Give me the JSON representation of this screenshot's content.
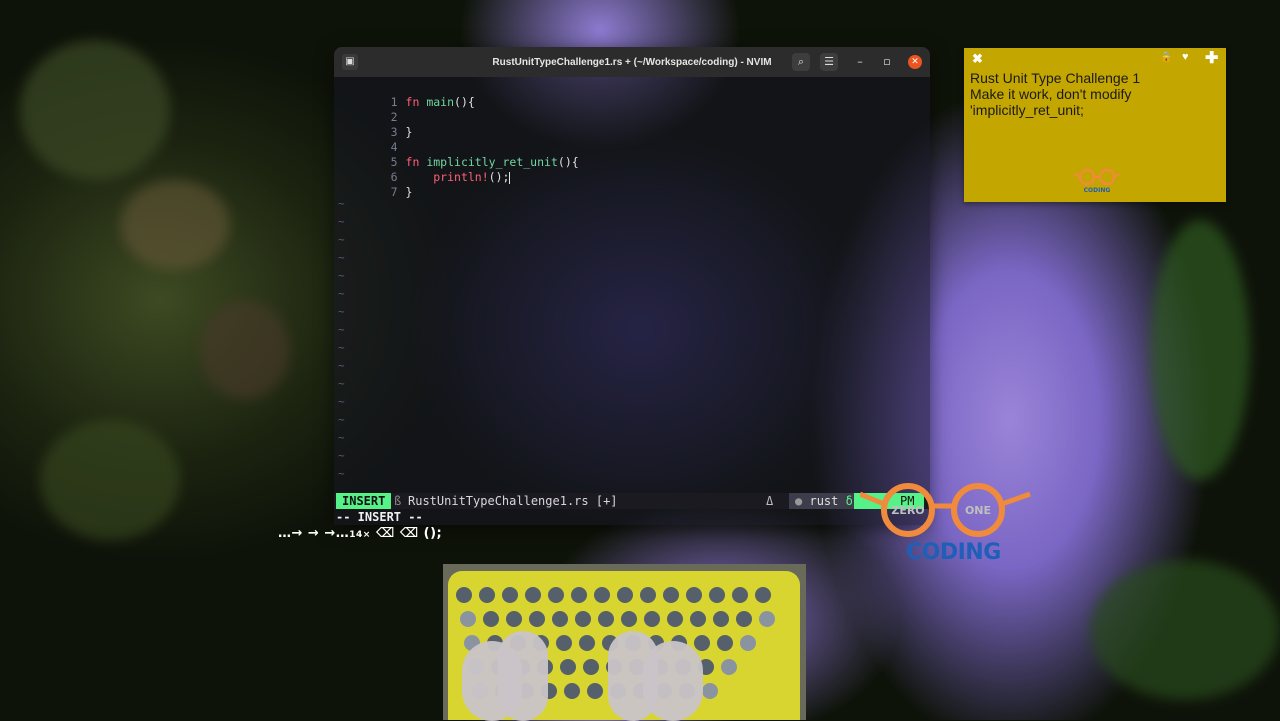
{
  "window": {
    "title": "RustUnitTypeChallenge1.rs + (~/Workspace/coding) - NVIM"
  },
  "editor": {
    "lines": [
      {
        "num": "1",
        "parts": [
          "fn",
          " main",
          "(){"
        ]
      },
      {
        "num": "2"
      },
      {
        "num": "3",
        "text": "}"
      },
      {
        "num": "4"
      },
      {
        "num": "5",
        "parts": [
          "fn",
          " implicitly_ret_unit",
          "(){"
        ]
      },
      {
        "num": "6",
        "macro": "println!",
        "rest": "();"
      },
      {
        "num": "7",
        "text": "}"
      }
    ]
  },
  "statusline": {
    "mode": "INSERT",
    "separator": "ß",
    "filename": "RustUnitTypeChallenge1.rs [+]",
    "delta": "Δ",
    "filetype_dot": "●",
    "filetype": "rust",
    "filetype_delta": "δ",
    "position_label": "PM"
  },
  "cmdline": "-- INSERT --",
  "keystrokes": {
    "arrows": "…→ → →…",
    "count": "14×",
    "rest": " ⌫ ⌫ ();"
  },
  "sticky_note": {
    "close": "✖",
    "lock": "🔒",
    "heart": "♥",
    "plus": "✚",
    "line1": "Rust Unit Type Challenge 1",
    "line2": "Make it work, don't modify",
    "line3": "'implicitly_ret_unit;",
    "logo_text": "CODING"
  },
  "logo": {
    "left_word": "ZERO",
    "right_word": "ONE",
    "bottom_word": "CODING",
    "color_orange": "#f08a3c",
    "color_blue": "#1f5fb8"
  },
  "colors": {
    "mode_green": "#57f287",
    "keyword": "#ff5f7a",
    "function": "#6fd6a0",
    "sticky_bg": "#c4a600"
  }
}
